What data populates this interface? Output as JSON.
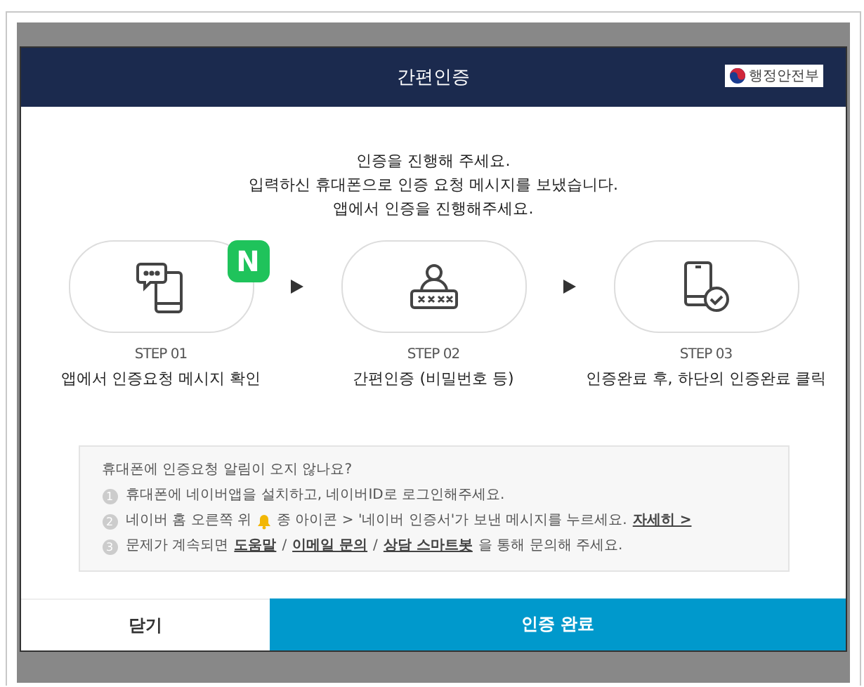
{
  "window": {
    "title": "간편인증",
    "logo_text": "행정안전부"
  },
  "intro": [
    "인증을 진행해 주세요.",
    "입력하신 휴대폰으로 인증 요청 메시지를 보냈습니다.",
    "앱에서 인증을 진행해주세요."
  ],
  "steps": [
    {
      "kind": "message",
      "badge": "N",
      "step": "STEP 01",
      "label": "앱에서 인증요청 메시지 확인"
    },
    {
      "kind": "password",
      "step": "STEP 02",
      "label": "간편인증 (비밀번호 등)"
    },
    {
      "kind": "confirm",
      "step": "STEP 03",
      "label": "인증완료 후, 하단의 인증완료 클릭"
    }
  ],
  "help": {
    "title": "휴대폰에 인증요청 알림이 오지 않나요?",
    "items": [
      {
        "number": "1",
        "parts": [
          {
            "kind": "text",
            "text": "휴대폰에 네이버앱을 설치하고, 네이버ID로 로그인해주세요."
          }
        ]
      },
      {
        "number": "2",
        "parts": [
          {
            "kind": "text",
            "text": "네이버 홈 오른쪽 위"
          },
          {
            "kind": "bell"
          },
          {
            "kind": "text",
            "text": "종 아이콘 > '네이버 인증서'가 보낸 메시지를 누르세요."
          },
          {
            "kind": "link",
            "text": "자세히 >"
          }
        ]
      },
      {
        "number": "3",
        "parts": [
          {
            "kind": "text",
            "text": "문제가 계속되면"
          },
          {
            "kind": "link",
            "text": "도움말"
          },
          {
            "kind": "text",
            "text": "/"
          },
          {
            "kind": "link",
            "text": "이메일 문의"
          },
          {
            "kind": "text",
            "text": "/"
          },
          {
            "kind": "link",
            "text": "상담 스마트봇"
          },
          {
            "kind": "text",
            "text": "을 통해 문의해 주세요."
          }
        ]
      }
    ]
  },
  "buttons": [
    {
      "label": "닫기",
      "kind": "secondary"
    },
    {
      "label": "인증 완료",
      "kind": "primary"
    }
  ]
}
